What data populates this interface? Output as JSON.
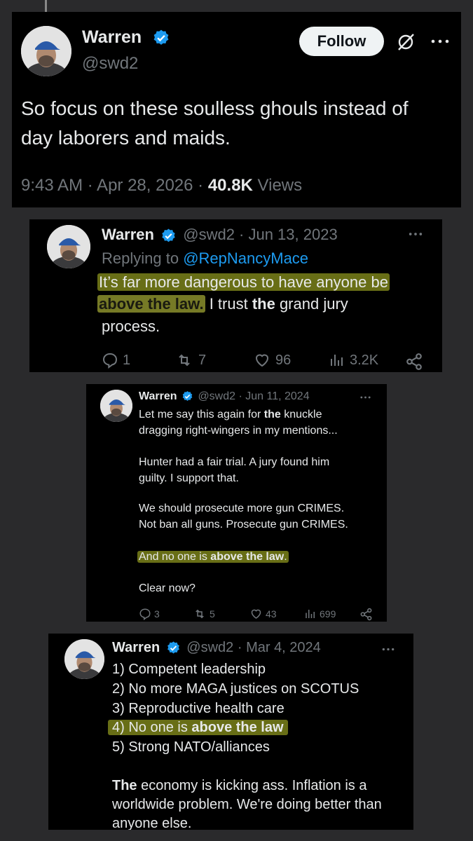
{
  "tweet_main": {
    "name": "Warren",
    "handle": "@swd2",
    "follow_label": "Follow",
    "text_line1": "So focus on these soulless ghouls instead of",
    "text_line2": "day laborers and maids.",
    "time": "9:43 AM · Apr 28, 2026 · ",
    "views_count": "40.8K",
    "views_label": "Views"
  },
  "tweet_2": {
    "name": "Warren",
    "meta": "@swd2 · Jun 13, 2023",
    "replying_prefix": "Replying to ",
    "replying_handle": "@RepNancyMace",
    "line1": "It’s far more dangerous to have anyone be",
    "line2_hl": "above the law.",
    "line2_rest_a": " I trust ",
    "line2_bold": "the",
    "line2_rest_b": " grand jury",
    "line3": "process.",
    "replies": "1",
    "reposts": "7",
    "likes": "96",
    "views": "3.2K"
  },
  "tweet_3": {
    "name": "Warren",
    "meta": "@swd2 · Jun 11, 2024",
    "line1_a": "Let me say this again for ",
    "line1_bold": "the",
    "line1_b": " knuckle",
    "line2": "dragging right-wingers in my mentions...",
    "line3": "Hunter had a fair trial. A jury found him",
    "line4": "guilty. I support that.",
    "line5": "We should prosecute more gun CRIMES.",
    "line6": "Not ban all guns. Prosecute gun CRIMES.",
    "line7_a": "And no one is ",
    "line7_bold": "above the law",
    "line7_b": ".",
    "line8": "Clear now?",
    "replies": "3",
    "reposts": "5",
    "likes": "43",
    "views": "699"
  },
  "tweet_4": {
    "name": "Warren",
    "meta": "@swd2 · Mar 4, 2024",
    "item1": "1) Competent leadership",
    "item2": "2) No more MAGA justices on SCOTUS",
    "item3": "3) Reproductive health care",
    "item4_a": "4) No one is ",
    "item4_bold": "above the law",
    "item5": "5) Strong NATO/alliances",
    "p_bold": "The",
    "p_rest": " economy is kicking ass. Inflation is a",
    "p_line2": "worldwide problem. We're doing better than",
    "p_line3": "anyone else."
  },
  "colors": {
    "background": "#2a2a2c",
    "card": "#000000",
    "verified": "#1d9bf0",
    "highlight": "#d7de46",
    "muted": "#71767b"
  },
  "icons": [
    "verified-badge-icon",
    "grok-icon",
    "more-icon",
    "reply-icon",
    "repost-icon",
    "like-icon",
    "views-icon",
    "share-icon"
  ]
}
